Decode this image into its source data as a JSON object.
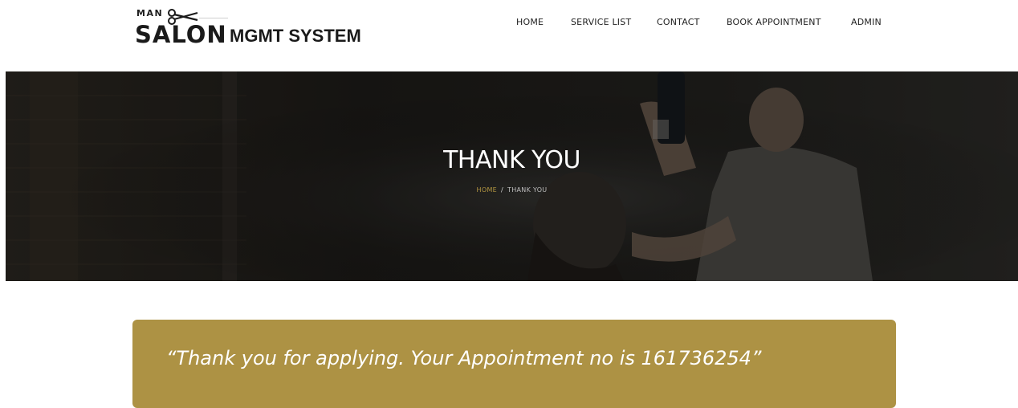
{
  "brand": {
    "logo_man": "MAN",
    "logo_salon": "SALON",
    "logo_mgmt": "MGMT SYSTEM"
  },
  "nav": {
    "items": [
      {
        "label": "HOME"
      },
      {
        "label": "SERVICE LIST"
      },
      {
        "label": "CONTACT"
      },
      {
        "label": "BOOK APPOINTMENT"
      },
      {
        "label": "ADMIN"
      }
    ]
  },
  "banner": {
    "title": "THANK YOU",
    "breadcrumb": {
      "home": "HOME",
      "separator": "/",
      "current": "THANK YOU"
    }
  },
  "message": {
    "text": "“Thank you for applying. Your Appointment no is 161736254”"
  },
  "colors": {
    "accent_gold": "#ad9244",
    "banner_dark": "#1b1a18",
    "text_dark": "#222222"
  }
}
